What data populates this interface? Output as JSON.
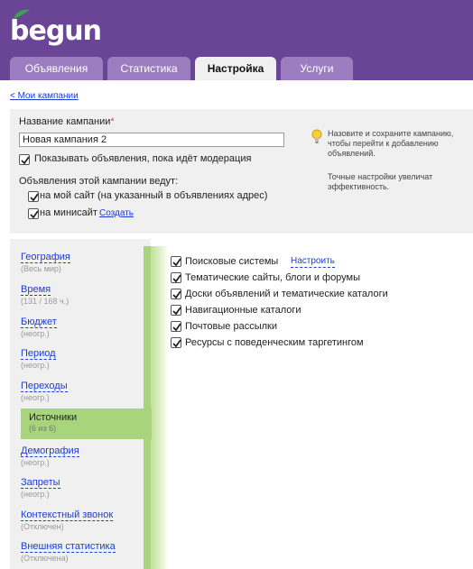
{
  "brand": {
    "logo_text": "begun",
    "color": "#6a4596",
    "leaf_color": "#3aa24a"
  },
  "tabs": [
    {
      "label": "Объявления",
      "active": false
    },
    {
      "label": "Статистика",
      "active": false
    },
    {
      "label": "Настройка",
      "active": true
    },
    {
      "label": "Услуги",
      "active": false
    }
  ],
  "back_link": "< Мои кампании",
  "campaign": {
    "name_label": "Название кампании",
    "required_mark": "*",
    "name_value": "Новая кампания 2",
    "show_during_moderation": {
      "label": "Показывать объявления, пока идёт модерация",
      "checked": true
    },
    "lead_to_label": "Объявления этой кампании ведут:",
    "to_my_site": {
      "label": "на мой сайт (на указанный в объявлениях адрес)",
      "checked": true
    },
    "to_minisite": {
      "label": "на минисайт",
      "checked": true,
      "create_link": "Создать"
    }
  },
  "tip": {
    "icon": "lightbulb-icon",
    "text1": "Назовите и сохраните кампанию, чтобы перейти к добавлению объявлений.",
    "text2": "Точные настройки увеличат эффективность."
  },
  "sidebar": {
    "items": [
      {
        "title": "География",
        "sub": "(Весь мир)",
        "active": false
      },
      {
        "title": "Время",
        "sub": "(131 / 168 ч.)",
        "active": false
      },
      {
        "title": "Бюджет",
        "sub": "(неогр.)",
        "active": false
      },
      {
        "title": "Период",
        "sub": "(неогр.)",
        "active": false
      },
      {
        "title": "Переходы",
        "sub": "(неогр.)",
        "active": false
      },
      {
        "title": "Источники",
        "sub": "(6 из 6)",
        "active": true
      },
      {
        "title": "Демография",
        "sub": "(неогр.)",
        "active": false
      },
      {
        "title": "Запреты",
        "sub": "(неогр.)",
        "active": false
      },
      {
        "title": "Контекстный звонок",
        "sub": "(Отключен)",
        "active": false
      },
      {
        "title": "Внешняя статистика",
        "sub": "(Отключена)",
        "active": false
      }
    ]
  },
  "sources": {
    "configure_link": "Настроить",
    "items": [
      {
        "label": "Поисковые системы",
        "checked": true
      },
      {
        "label": "Тематические сайты, блоги и форумы",
        "checked": true
      },
      {
        "label": "Доски объявлений и тематические каталоги",
        "checked": true
      },
      {
        "label": "Навигационные каталоги",
        "checked": true
      },
      {
        "label": "Почтовые рассылки",
        "checked": true
      },
      {
        "label": "Ресурсы с поведенческим таргетингом",
        "checked": true
      }
    ]
  }
}
